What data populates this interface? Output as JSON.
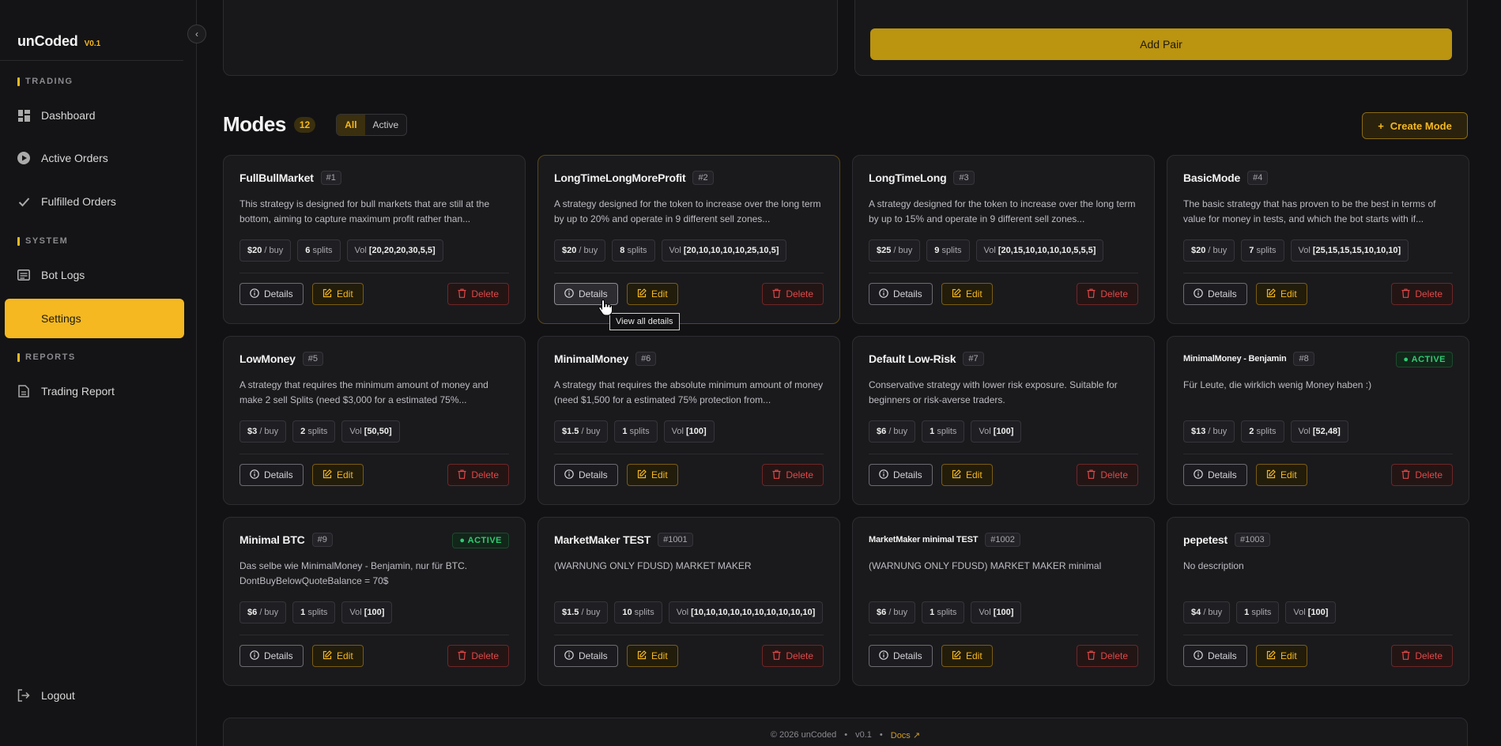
{
  "brand": {
    "name": "unCoded",
    "version": "V0.1"
  },
  "sidebar": {
    "sections": [
      {
        "label": "TRADING"
      },
      {
        "label": "SYSTEM"
      },
      {
        "label": "REPORTS"
      }
    ],
    "items": [
      {
        "label": "Dashboard",
        "icon": "dashboard-icon"
      },
      {
        "label": "Active Orders",
        "icon": "play-circle-icon"
      },
      {
        "label": "Fulfilled Orders",
        "icon": "check-icon"
      },
      {
        "label": "Bot Logs",
        "icon": "logs-icon"
      },
      {
        "label": "Settings",
        "icon": "settings-icon",
        "active": true
      },
      {
        "label": "Trading Report",
        "icon": "report-icon"
      },
      {
        "label": "Logout",
        "icon": "logout-icon"
      }
    ]
  },
  "top": {
    "add_pair_label": "Add Pair"
  },
  "modes": {
    "title": "Modes",
    "count": "12",
    "filters": [
      "All",
      "Active"
    ],
    "create_label": "Create Mode",
    "cards": [
      {
        "name": "FullBullMarket",
        "id": "#1",
        "desc": "This strategy is designed for bull markets that are still at the bottom, aiming to capture maximum profit rather than...",
        "buy": "$20",
        "splits": "6",
        "vol": "[20,20,20,30,5,5]"
      },
      {
        "name": "LongTimeLongMoreProfit",
        "id": "#2",
        "desc": "A strategy designed for the token to increase over the long term by up to 20% and operate in 9 different sell zones...",
        "buy": "$20",
        "splits": "8",
        "vol": "[20,10,10,10,10,25,10,5]"
      },
      {
        "name": "LongTimeLong",
        "id": "#3",
        "desc": "A strategy designed for the token to increase over the long term by up to 15% and operate in 9 different sell zones...",
        "buy": "$25",
        "splits": "9",
        "vol": "[20,15,10,10,10,10,5,5,5]"
      },
      {
        "name": "BasicMode",
        "id": "#4",
        "desc": "The basic strategy that has proven to be the best in terms of value for money in tests, and which the bot starts with if...",
        "buy": "$20",
        "splits": "7",
        "vol": "[25,15,15,15,10,10,10]"
      },
      {
        "name": "LowMoney",
        "id": "#5",
        "desc": "A strategy that requires the minimum amount of money and make 2 sell Splits (need $3,000 for a estimated 75%...",
        "buy": "$3",
        "splits": "2",
        "vol": "[50,50]"
      },
      {
        "name": "MinimalMoney",
        "id": "#6",
        "desc": "A strategy that requires the absolute minimum amount of money (need $1,500 for a estimated 75% protection from...",
        "buy": "$1.5",
        "splits": "1",
        "vol": "[100]"
      },
      {
        "name": "Default Low-Risk",
        "id": "#7",
        "desc": "Conservative strategy with lower risk exposure. Suitable for beginners or risk-averse traders.",
        "buy": "$6",
        "splits": "1",
        "vol": "[100]"
      },
      {
        "name": "MinimalMoney - Benjamin",
        "id": "#8",
        "active": "ACTIVE",
        "desc": "Für Leute, die wirklich wenig Money haben :)",
        "buy": "$13",
        "splits": "2",
        "vol": "[52,48]"
      },
      {
        "name": "Minimal BTC",
        "id": "#9",
        "active": "ACTIVE",
        "desc": "Das selbe wie MinimalMoney - Benjamin, nur für BTC. DontBuyBelowQuoteBalance = 70$",
        "buy": "$6",
        "splits": "1",
        "vol": "[100]"
      },
      {
        "name": "MarketMaker TEST",
        "id": "#1001",
        "desc": "(WARNUNG ONLY FDUSD) MARKET MAKER",
        "buy": "$1.5",
        "splits": "10",
        "vol": "[10,10,10,10,10,10,10,10,10,10]"
      },
      {
        "name": "MarketMaker minimal TEST",
        "id": "#1002",
        "desc": "(WARNUNG ONLY FDUSD) MARKET MAKER minimal",
        "buy": "$6",
        "splits": "1",
        "vol": "[100]"
      },
      {
        "name": "pepetest",
        "id": "#1003",
        "desc": "No description",
        "buy": "$4",
        "splits": "1",
        "vol": "[100]"
      }
    ],
    "labels": {
      "per_buy": "/ buy",
      "splits": "splits",
      "vol": "Vol",
      "details": "Details",
      "edit": "Edit",
      "delete": "Delete"
    },
    "tooltip": "View all details"
  },
  "footer": {
    "copyright": "© 2026 unCoded",
    "sep": "•",
    "version": "v0.1",
    "docs": "Docs"
  },
  "colors": {
    "accent": "#f5b820",
    "danger": "#e04848",
    "success": "#2ecc71"
  }
}
